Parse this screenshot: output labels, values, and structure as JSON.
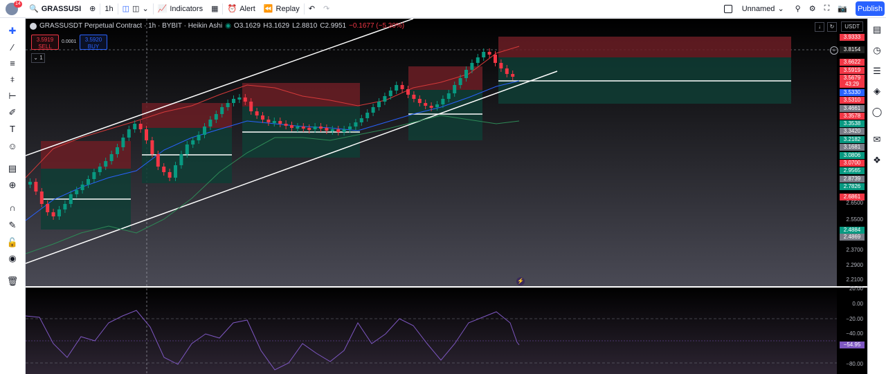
{
  "header": {
    "notification_count": "14",
    "symbol": "GRASSUSI",
    "timeframe": "1h",
    "indicators_label": "Indicators",
    "alert_label": "Alert",
    "replay_label": "Replay",
    "layout_name": "Unnamed",
    "publish_label": "Publish"
  },
  "legend": {
    "title": "GRASSUSDT Perpetual Contract · 1h · BYBIT · Heikin Ashi",
    "open": "O3.1629",
    "high": "H3.1629",
    "low": "L2.8810",
    "close": "C2.9951",
    "change": "−0.1677 (−5.30%)"
  },
  "trade": {
    "sell_price": "3.5919",
    "sell_label": "SELL",
    "spread": "0.0001",
    "buy_price": "3.5920",
    "buy_label": "BUY",
    "collapse_count": "1",
    "currency": "USDT"
  },
  "price_labels": [
    {
      "text": "3.9333",
      "color": "#f23645"
    },
    {
      "text": "3.8154",
      "color": "#1f1f1f"
    },
    {
      "text": "3.6622",
      "color": "#f23645"
    },
    {
      "text": "3.5919",
      "color": "#f23645"
    },
    {
      "text": "3.5679",
      "color": "#f23645"
    },
    {
      "text": "43:29",
      "color": "#f23645"
    },
    {
      "text": "3.5330",
      "color": "#2962ff"
    },
    {
      "text": "3.5310",
      "color": "#f23645"
    },
    {
      "text": "3.4661",
      "color": "#787b86"
    },
    {
      "text": "3.3578",
      "color": "#f23645"
    },
    {
      "text": "3.3538",
      "color": "#089981"
    },
    {
      "text": "3.3420",
      "color": "#787b86"
    },
    {
      "text": "3.2182",
      "color": "#089981"
    },
    {
      "text": "3.1681",
      "color": "#787b86"
    },
    {
      "text": "3.0806",
      "color": "#089981"
    },
    {
      "text": "3.0700",
      "color": "#f23645"
    },
    {
      "text": "2.9565",
      "color": "#089981"
    },
    {
      "text": "2.8739",
      "color": "#787b86"
    },
    {
      "text": "2.7826",
      "color": "#089981"
    },
    {
      "text": "2.6861",
      "color": "#f23645"
    },
    {
      "text": "2.4884",
      "color": "#089981"
    },
    {
      "text": "2.4869",
      "color": "#787b86"
    }
  ],
  "price_ticks": [
    "2.6500",
    "2.5500",
    "2.3700",
    "2.2900",
    "2.2100"
  ],
  "osc_ticks": [
    "20.00",
    "0.00",
    "−20.00",
    "−40.00",
    "−80.00"
  ],
  "osc_value": "−54.95",
  "colors": {
    "bull": "#089981",
    "bear": "#f23645",
    "ma_red": "#e23b3b",
    "ma_blue": "#2962ff",
    "ma_green": "#2e8b57",
    "osc": "#7e57c2"
  }
}
